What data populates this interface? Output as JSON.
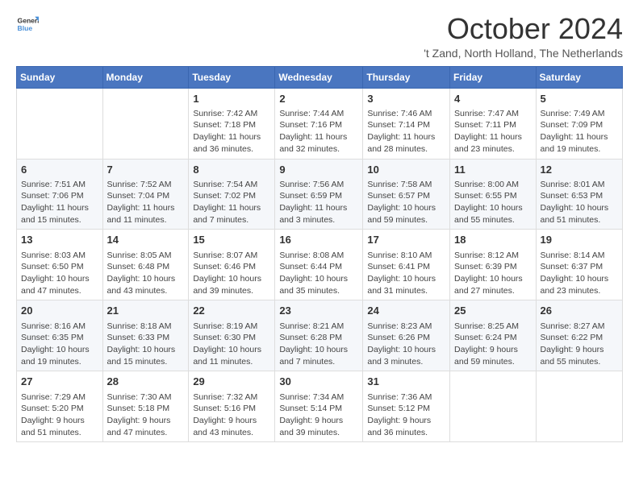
{
  "header": {
    "logo_general": "General",
    "logo_blue": "Blue",
    "month_title": "October 2024",
    "location": "'t Zand, North Holland, The Netherlands"
  },
  "weekdays": [
    "Sunday",
    "Monday",
    "Tuesday",
    "Wednesday",
    "Thursday",
    "Friday",
    "Saturday"
  ],
  "weeks": [
    [
      {
        "day": "",
        "sunrise": "",
        "sunset": "",
        "daylight": ""
      },
      {
        "day": "",
        "sunrise": "",
        "sunset": "",
        "daylight": ""
      },
      {
        "day": "1",
        "sunrise": "Sunrise: 7:42 AM",
        "sunset": "Sunset: 7:18 PM",
        "daylight": "Daylight: 11 hours and 36 minutes."
      },
      {
        "day": "2",
        "sunrise": "Sunrise: 7:44 AM",
        "sunset": "Sunset: 7:16 PM",
        "daylight": "Daylight: 11 hours and 32 minutes."
      },
      {
        "day": "3",
        "sunrise": "Sunrise: 7:46 AM",
        "sunset": "Sunset: 7:14 PM",
        "daylight": "Daylight: 11 hours and 28 minutes."
      },
      {
        "day": "4",
        "sunrise": "Sunrise: 7:47 AM",
        "sunset": "Sunset: 7:11 PM",
        "daylight": "Daylight: 11 hours and 23 minutes."
      },
      {
        "day": "5",
        "sunrise": "Sunrise: 7:49 AM",
        "sunset": "Sunset: 7:09 PM",
        "daylight": "Daylight: 11 hours and 19 minutes."
      }
    ],
    [
      {
        "day": "6",
        "sunrise": "Sunrise: 7:51 AM",
        "sunset": "Sunset: 7:06 PM",
        "daylight": "Daylight: 11 hours and 15 minutes."
      },
      {
        "day": "7",
        "sunrise": "Sunrise: 7:52 AM",
        "sunset": "Sunset: 7:04 PM",
        "daylight": "Daylight: 11 hours and 11 minutes."
      },
      {
        "day": "8",
        "sunrise": "Sunrise: 7:54 AM",
        "sunset": "Sunset: 7:02 PM",
        "daylight": "Daylight: 11 hours and 7 minutes."
      },
      {
        "day": "9",
        "sunrise": "Sunrise: 7:56 AM",
        "sunset": "Sunset: 6:59 PM",
        "daylight": "Daylight: 11 hours and 3 minutes."
      },
      {
        "day": "10",
        "sunrise": "Sunrise: 7:58 AM",
        "sunset": "Sunset: 6:57 PM",
        "daylight": "Daylight: 10 hours and 59 minutes."
      },
      {
        "day": "11",
        "sunrise": "Sunrise: 8:00 AM",
        "sunset": "Sunset: 6:55 PM",
        "daylight": "Daylight: 10 hours and 55 minutes."
      },
      {
        "day": "12",
        "sunrise": "Sunrise: 8:01 AM",
        "sunset": "Sunset: 6:53 PM",
        "daylight": "Daylight: 10 hours and 51 minutes."
      }
    ],
    [
      {
        "day": "13",
        "sunrise": "Sunrise: 8:03 AM",
        "sunset": "Sunset: 6:50 PM",
        "daylight": "Daylight: 10 hours and 47 minutes."
      },
      {
        "day": "14",
        "sunrise": "Sunrise: 8:05 AM",
        "sunset": "Sunset: 6:48 PM",
        "daylight": "Daylight: 10 hours and 43 minutes."
      },
      {
        "day": "15",
        "sunrise": "Sunrise: 8:07 AM",
        "sunset": "Sunset: 6:46 PM",
        "daylight": "Daylight: 10 hours and 39 minutes."
      },
      {
        "day": "16",
        "sunrise": "Sunrise: 8:08 AM",
        "sunset": "Sunset: 6:44 PM",
        "daylight": "Daylight: 10 hours and 35 minutes."
      },
      {
        "day": "17",
        "sunrise": "Sunrise: 8:10 AM",
        "sunset": "Sunset: 6:41 PM",
        "daylight": "Daylight: 10 hours and 31 minutes."
      },
      {
        "day": "18",
        "sunrise": "Sunrise: 8:12 AM",
        "sunset": "Sunset: 6:39 PM",
        "daylight": "Daylight: 10 hours and 27 minutes."
      },
      {
        "day": "19",
        "sunrise": "Sunrise: 8:14 AM",
        "sunset": "Sunset: 6:37 PM",
        "daylight": "Daylight: 10 hours and 23 minutes."
      }
    ],
    [
      {
        "day": "20",
        "sunrise": "Sunrise: 8:16 AM",
        "sunset": "Sunset: 6:35 PM",
        "daylight": "Daylight: 10 hours and 19 minutes."
      },
      {
        "day": "21",
        "sunrise": "Sunrise: 8:18 AM",
        "sunset": "Sunset: 6:33 PM",
        "daylight": "Daylight: 10 hours and 15 minutes."
      },
      {
        "day": "22",
        "sunrise": "Sunrise: 8:19 AM",
        "sunset": "Sunset: 6:30 PM",
        "daylight": "Daylight: 10 hours and 11 minutes."
      },
      {
        "day": "23",
        "sunrise": "Sunrise: 8:21 AM",
        "sunset": "Sunset: 6:28 PM",
        "daylight": "Daylight: 10 hours and 7 minutes."
      },
      {
        "day": "24",
        "sunrise": "Sunrise: 8:23 AM",
        "sunset": "Sunset: 6:26 PM",
        "daylight": "Daylight: 10 hours and 3 minutes."
      },
      {
        "day": "25",
        "sunrise": "Sunrise: 8:25 AM",
        "sunset": "Sunset: 6:24 PM",
        "daylight": "Daylight: 9 hours and 59 minutes."
      },
      {
        "day": "26",
        "sunrise": "Sunrise: 8:27 AM",
        "sunset": "Sunset: 6:22 PM",
        "daylight": "Daylight: 9 hours and 55 minutes."
      }
    ],
    [
      {
        "day": "27",
        "sunrise": "Sunrise: 7:29 AM",
        "sunset": "Sunset: 5:20 PM",
        "daylight": "Daylight: 9 hours and 51 minutes."
      },
      {
        "day": "28",
        "sunrise": "Sunrise: 7:30 AM",
        "sunset": "Sunset: 5:18 PM",
        "daylight": "Daylight: 9 hours and 47 minutes."
      },
      {
        "day": "29",
        "sunrise": "Sunrise: 7:32 AM",
        "sunset": "Sunset: 5:16 PM",
        "daylight": "Daylight: 9 hours and 43 minutes."
      },
      {
        "day": "30",
        "sunrise": "Sunrise: 7:34 AM",
        "sunset": "Sunset: 5:14 PM",
        "daylight": "Daylight: 9 hours and 39 minutes."
      },
      {
        "day": "31",
        "sunrise": "Sunrise: 7:36 AM",
        "sunset": "Sunset: 5:12 PM",
        "daylight": "Daylight: 9 hours and 36 minutes."
      },
      {
        "day": "",
        "sunrise": "",
        "sunset": "",
        "daylight": ""
      },
      {
        "day": "",
        "sunrise": "",
        "sunset": "",
        "daylight": ""
      }
    ]
  ]
}
